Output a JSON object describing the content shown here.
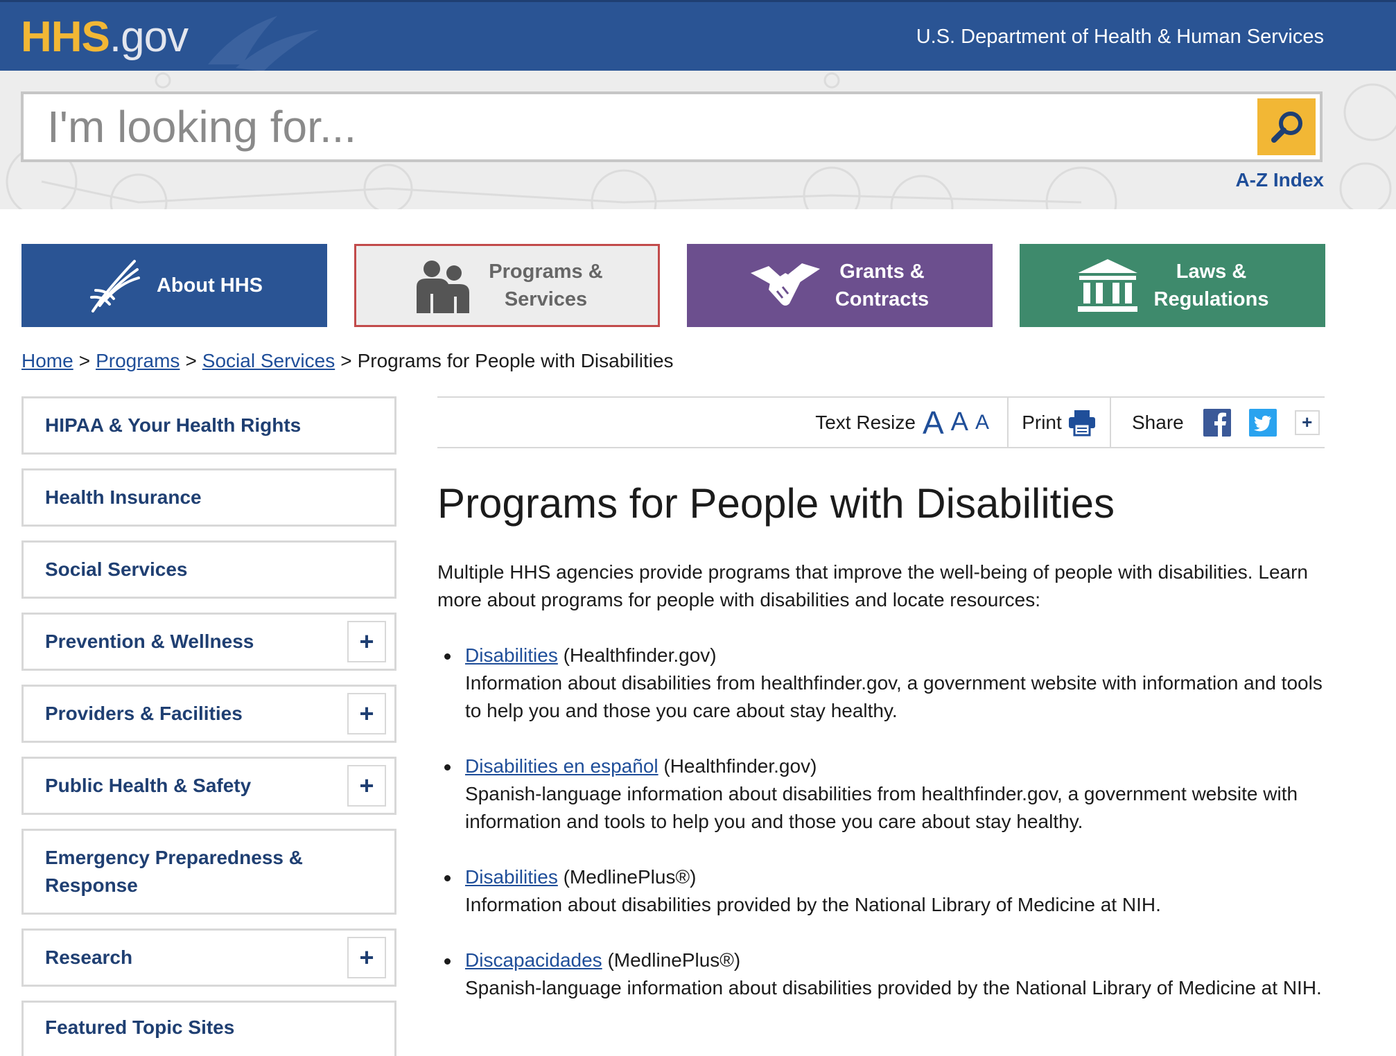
{
  "header": {
    "logo_hhs": "HHS",
    "logo_gov": ".gov",
    "department": "U.S. Department of Health & Human Services"
  },
  "search": {
    "placeholder": "I'm looking for...",
    "button_icon": "search-icon",
    "az_index": "A-Z Index"
  },
  "nav_tiles": [
    {
      "label_line1": "About HHS",
      "label_line2": "",
      "icon": "eagle-icon",
      "color": "#2a5494"
    },
    {
      "label_line1": "Programs &",
      "label_line2": "Services",
      "icon": "people-icon",
      "color": "#ededed",
      "active": true
    },
    {
      "label_line1": "Grants &",
      "label_line2": "Contracts",
      "icon": "handshake-icon",
      "color": "#6c4f8e"
    },
    {
      "label_line1": "Laws &",
      "label_line2": "Regulations",
      "icon": "building-icon",
      "color": "#3e8a6c"
    }
  ],
  "breadcrumb": {
    "items": [
      "Home",
      "Programs",
      "Social Services"
    ],
    "separator": ">",
    "current": "Programs for People with Disabilities"
  },
  "sidebar": {
    "items": [
      {
        "label_line1": "HIPAA & Your Health Rights",
        "label_line2": "",
        "expandable": false
      },
      {
        "label_line1": "Health Insurance",
        "label_line2": "",
        "expandable": false
      },
      {
        "label_line1": "Social Services",
        "label_line2": "",
        "expandable": false
      },
      {
        "label_line1": "Prevention & Wellness",
        "label_line2": "",
        "expandable": true
      },
      {
        "label_line1": "Providers & Facilities",
        "label_line2": "",
        "expandable": true
      },
      {
        "label_line1": "Public Health & Safety",
        "label_line2": "",
        "expandable": true
      },
      {
        "label_line1": "Emergency Preparedness &",
        "label_line2": "Response",
        "expandable": false
      },
      {
        "label_line1": "Research",
        "label_line2": "",
        "expandable": true
      },
      {
        "label_line1": "Featured Topic Sites",
        "label_line2": "",
        "expandable": false
      }
    ],
    "plus_symbol": "+"
  },
  "utility": {
    "text_resize": "Text Resize",
    "resize_a": "A",
    "print": "Print",
    "share": "Share",
    "more": "+"
  },
  "main": {
    "title": "Programs for People with Disabilities",
    "intro": "Multiple HHS agencies provide programs that improve the well-being of people with disabilities. Learn more about programs for people with disabilities and locate resources:",
    "resources": [
      {
        "link": "Disabilities",
        "source": "(Healthfinder.gov)",
        "description": "Information about disabilities from healthfinder.gov, a government website with information and tools to help you and those you care about stay healthy."
      },
      {
        "link": "Disabilities en español",
        "source": "(Healthfinder.gov)",
        "description": "Spanish-language information about disabilities from healthfinder.gov, a government website with information and tools to help you and those you care about stay healthy."
      },
      {
        "link": "Disabilities",
        "source": "(MedlinePlus®)",
        "description": "Information about disabilities provided by the National Library of Medicine at NIH."
      },
      {
        "link": "Discapacidades",
        "source": "(MedlinePlus®)",
        "description": "Spanish-language information about disabilities provided by the National Library of Medicine at NIH."
      }
    ]
  },
  "colors": {
    "header_blue": "#2a5494",
    "accent_yellow": "#f2b735",
    "link_blue": "#1f4e99",
    "grants_purple": "#6c4f8e",
    "laws_green": "#3e8a6c",
    "active_border_red": "#c24b4b"
  }
}
